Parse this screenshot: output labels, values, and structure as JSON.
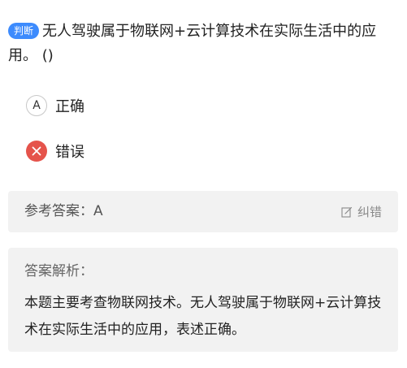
{
  "question": {
    "badge": "判断",
    "text": "无人驾驶属于物联网+云计算技术在实际生活中的应用。 ()"
  },
  "options": [
    {
      "letter": "A",
      "label": "正确",
      "state": "neutral"
    },
    {
      "letter": "",
      "label": "错误",
      "state": "selected-wrong",
      "icon": "close-icon",
      "color": "#e5534b"
    }
  ],
  "answer": {
    "text": "参考答案：A",
    "correction_label": "纠错",
    "correction_icon": "edit-icon"
  },
  "analysis": {
    "title": "答案解析：",
    "body": "本题主要考查物联网技术。无人驾驶属于物联网+云计算技术在实际生活中的应用，表述正确。"
  },
  "colors": {
    "badge": "#3d8bfd",
    "wrong": "#e5534b",
    "panel": "#f2f2f2"
  }
}
